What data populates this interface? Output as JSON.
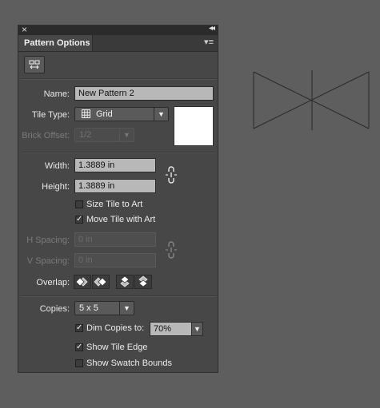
{
  "panel": {
    "close_glyph": "×",
    "collapse_glyph": "◂◂",
    "tab_title": "Pattern Options",
    "menu_glyph": "▾≡"
  },
  "name": {
    "label": "Name:",
    "value": "New Pattern 2"
  },
  "tile_type": {
    "label": "Tile Type:",
    "value": "Grid",
    "icon": "grid-icon"
  },
  "brick_offset": {
    "label": "Brick Offset:",
    "value": "1/2"
  },
  "width": {
    "label": "Width:",
    "value": "1.3889 in"
  },
  "height": {
    "label": "Height:",
    "value": "1.3889 in"
  },
  "size_tile_to_art": {
    "label": "Size Tile to Art",
    "checked": false
  },
  "move_tile_with_art": {
    "label": "Move Tile with Art",
    "checked": true
  },
  "h_spacing": {
    "label": "H Spacing:",
    "value": "0 in"
  },
  "v_spacing": {
    "label": "V Spacing:",
    "value": "0 in"
  },
  "overlap": {
    "label": "Overlap:"
  },
  "copies": {
    "label": "Copies:",
    "value": "5 x 5"
  },
  "dim_copies": {
    "label": "Dim Copies to:",
    "checked": true,
    "value": "70%"
  },
  "show_tile_edge": {
    "label": "Show Tile Edge",
    "checked": true
  },
  "show_swatch_bounds": {
    "label": "Show Swatch Bounds",
    "checked": false
  },
  "check_glyph": "✓",
  "colors": {
    "background": "#5e5e5e",
    "panel": "#474747",
    "field": "#b8b8b8"
  }
}
